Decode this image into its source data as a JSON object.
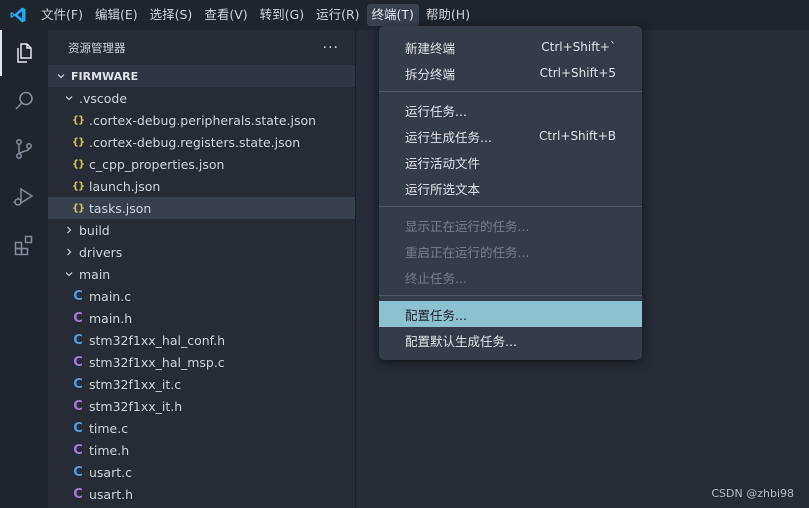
{
  "menubar": {
    "items": [
      "文件(F)",
      "编辑(E)",
      "选择(S)",
      "查看(V)",
      "转到(G)",
      "运行(R)",
      "终端(T)",
      "帮助(H)"
    ],
    "active_index": 6
  },
  "activity_bar": {
    "icons": [
      "explorer-icon",
      "search-icon",
      "source-control-icon",
      "run-debug-icon",
      "extensions-icon"
    ]
  },
  "explorer": {
    "title": "资源管理器",
    "more_label": "···",
    "folder_name": "FIRMWARE",
    "tree": [
      {
        "type": "folder",
        "label": ".vscode",
        "expanded": true,
        "depth": 1
      },
      {
        "type": "json",
        "label": ".cortex-debug.peripherals.state.json",
        "depth": 2
      },
      {
        "type": "json",
        "label": ".cortex-debug.registers.state.json",
        "depth": 2
      },
      {
        "type": "json",
        "label": "c_cpp_properties.json",
        "depth": 2
      },
      {
        "type": "json",
        "label": "launch.json",
        "depth": 2
      },
      {
        "type": "json",
        "label": "tasks.json",
        "depth": 2,
        "selected": true
      },
      {
        "type": "folder",
        "label": "build",
        "expanded": false,
        "depth": 1
      },
      {
        "type": "folder",
        "label": "drivers",
        "expanded": false,
        "depth": 1
      },
      {
        "type": "folder",
        "label": "main",
        "expanded": true,
        "depth": 1
      },
      {
        "type": "c",
        "label": "main.c",
        "depth": 2
      },
      {
        "type": "h",
        "label": "main.h",
        "depth": 2
      },
      {
        "type": "c",
        "label": "stm32f1xx_hal_conf.h",
        "depth": 2
      },
      {
        "type": "h",
        "label": "stm32f1xx_hal_msp.c",
        "depth": 2
      },
      {
        "type": "c",
        "label": "stm32f1xx_it.c",
        "depth": 2
      },
      {
        "type": "h",
        "label": "stm32f1xx_it.h",
        "depth": 2
      },
      {
        "type": "c",
        "label": "time.c",
        "depth": 2
      },
      {
        "type": "h",
        "label": "time.h",
        "depth": 2
      },
      {
        "type": "c",
        "label": "usart.c",
        "depth": 2
      },
      {
        "type": "h",
        "label": "usart.h",
        "depth": 2
      }
    ],
    "icon_glyphs": {
      "json": "{}",
      "c": "C",
      "h": "C"
    }
  },
  "terminal_menu": {
    "groups": [
      [
        {
          "label": "新建终端",
          "shortcut": "Ctrl+Shift+`"
        },
        {
          "label": "拆分终端",
          "shortcut": "Ctrl+Shift+5"
        }
      ],
      [
        {
          "label": "运行任务...",
          "shortcut": ""
        },
        {
          "label": "运行生成任务...",
          "shortcut": "Ctrl+Shift+B"
        },
        {
          "label": "运行活动文件",
          "shortcut": ""
        },
        {
          "label": "运行所选文本",
          "shortcut": ""
        }
      ],
      [
        {
          "label": "显示正在运行的任务...",
          "shortcut": "",
          "disabled": true
        },
        {
          "label": "重启正在运行的任务...",
          "shortcut": "",
          "disabled": true
        },
        {
          "label": "终止任务...",
          "shortcut": "",
          "disabled": true
        }
      ],
      [
        {
          "label": "配置任务...",
          "shortcut": "",
          "highlighted": true
        },
        {
          "label": "配置默认生成任务...",
          "shortcut": ""
        }
      ]
    ]
  },
  "watermark": "CSDN @zhbi98",
  "colors": {
    "accent_highlight": "#8cc2d0",
    "json_icon": "#d8c04a",
    "c_icon": "#569ad8",
    "h_icon": "#a57ad6",
    "vscode_logo": "#23a9f2"
  }
}
